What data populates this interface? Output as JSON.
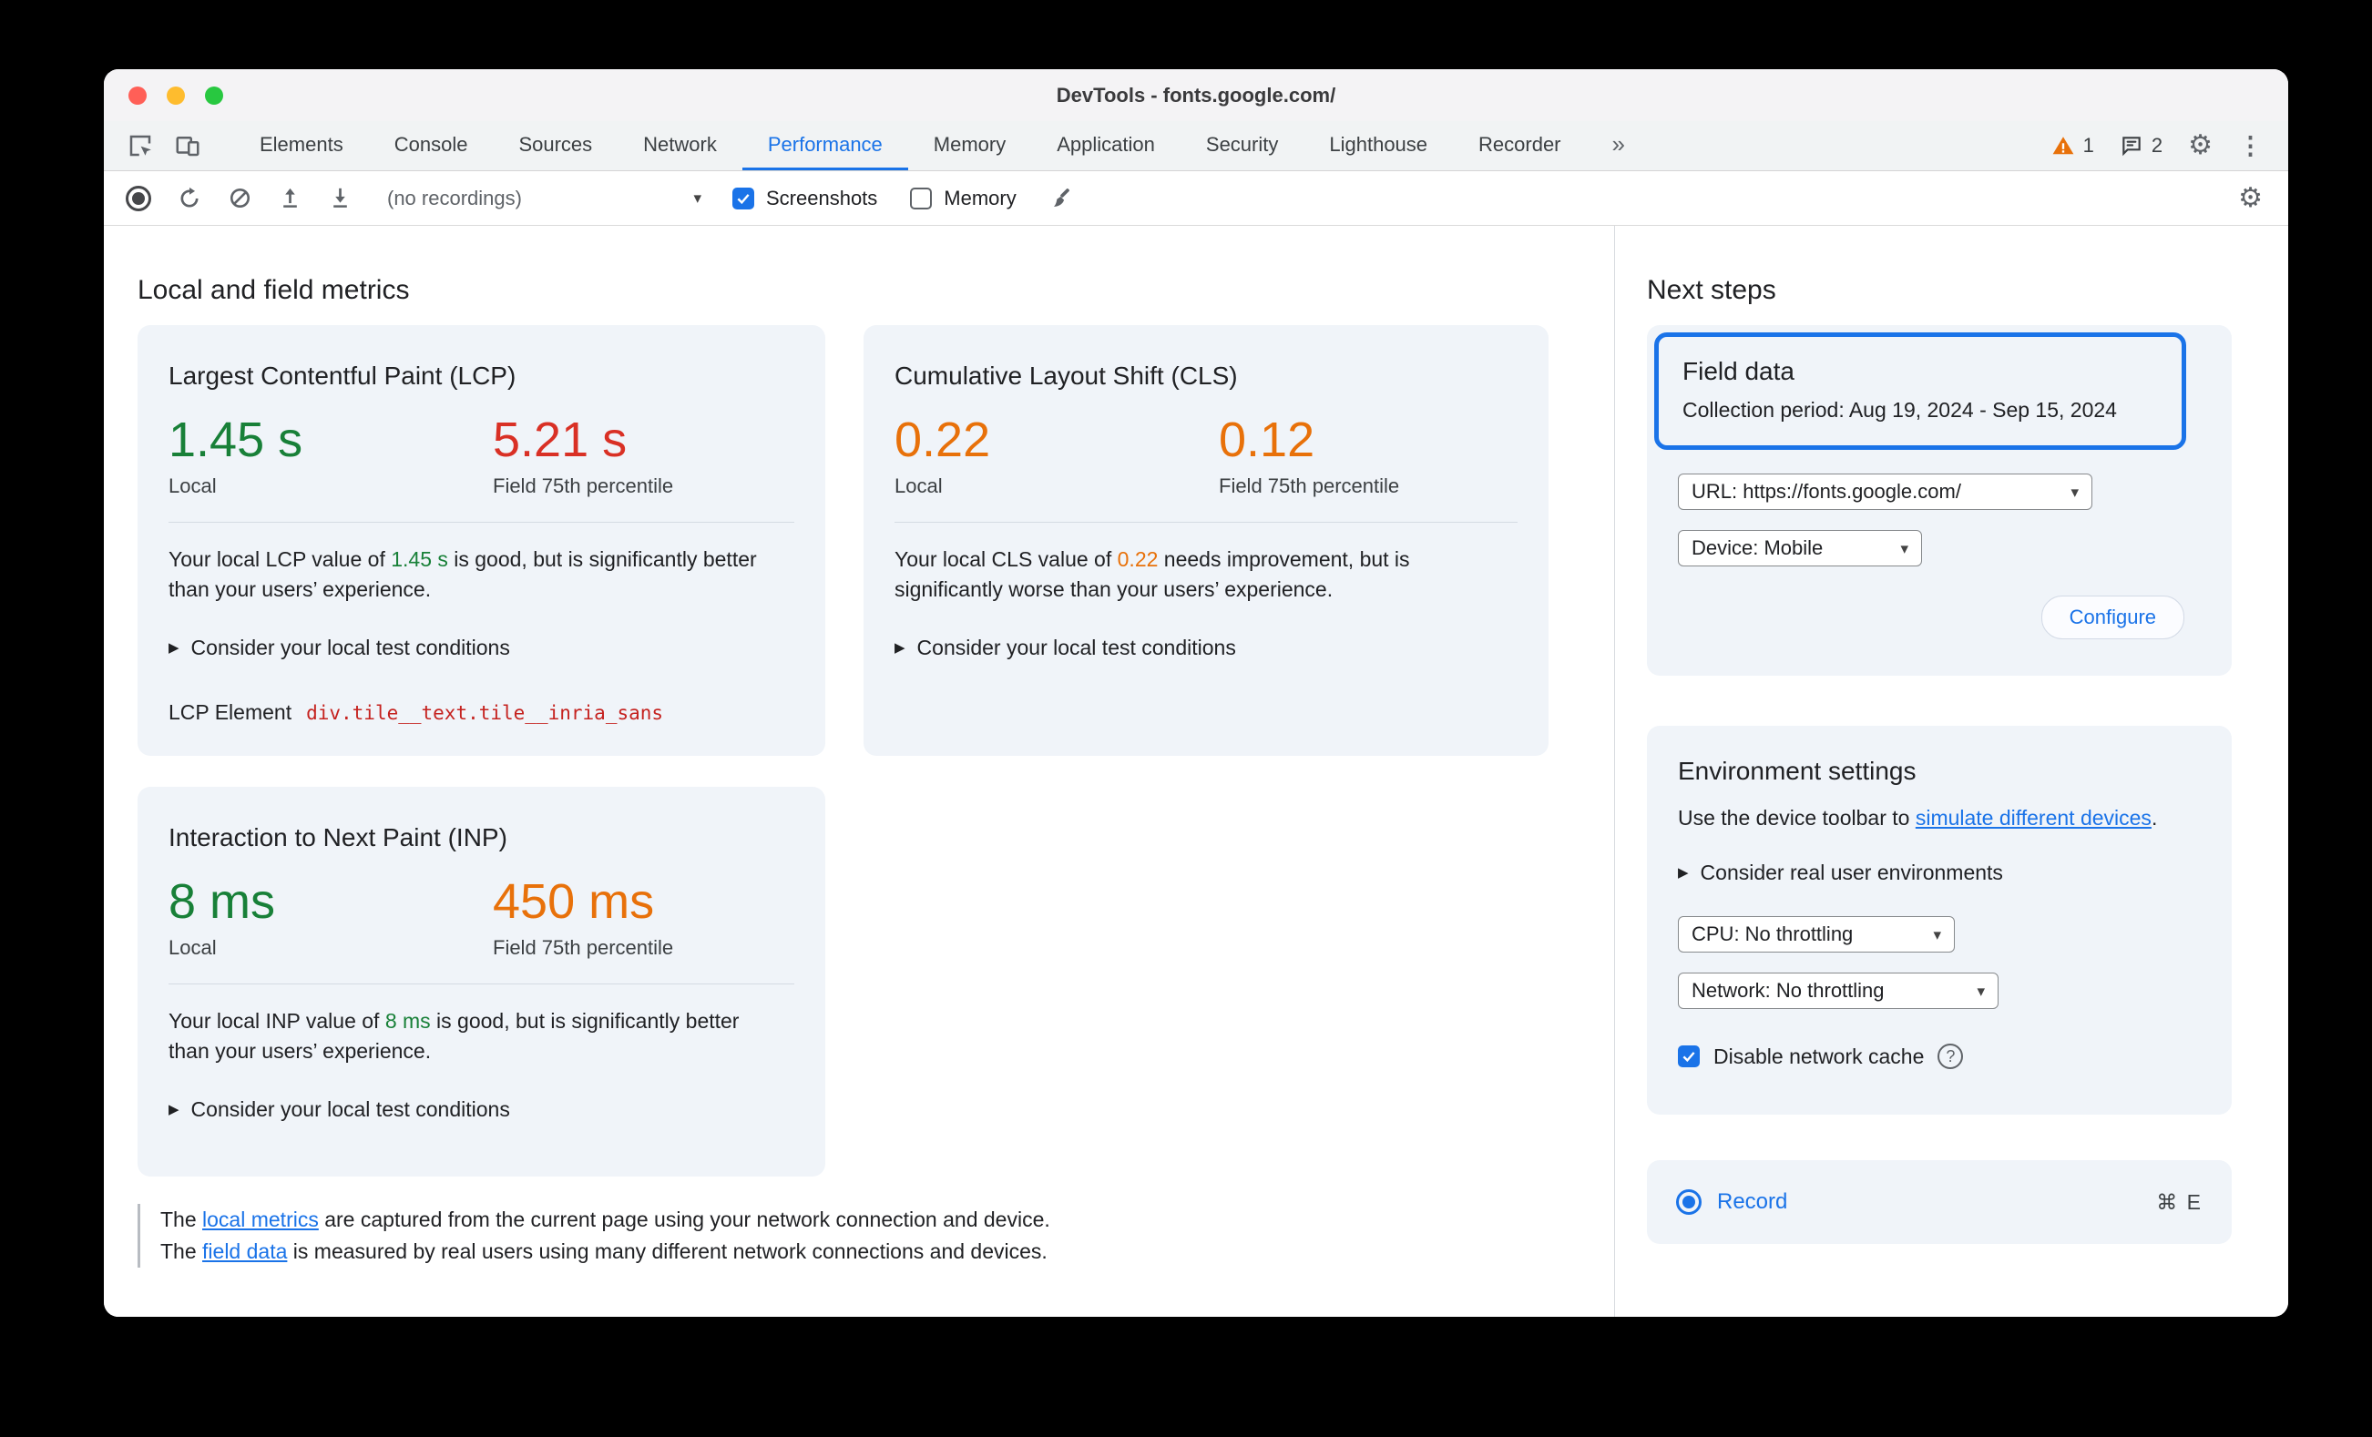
{
  "colors": {
    "good_green": "#188038",
    "poor_red": "#d93025",
    "warn_orange": "#e8710a",
    "accent_blue": "#1a73e8"
  },
  "icons": {
    "gear": "⚙",
    "kebab": "⋮",
    "caret": "▾",
    "disclosure": "▶",
    "more_tabs": "»",
    "help": "?"
  },
  "window": {
    "title": "DevTools - fonts.google.com/"
  },
  "tabbar": {
    "tabs": [
      {
        "label": "Elements"
      },
      {
        "label": "Console"
      },
      {
        "label": "Sources"
      },
      {
        "label": "Network"
      },
      {
        "label": "Performance"
      },
      {
        "label": "Memory"
      },
      {
        "label": "Application"
      },
      {
        "label": "Security"
      },
      {
        "label": "Lighthouse"
      },
      {
        "label": "Recorder"
      }
    ],
    "active_tab": "Performance",
    "warning_count": "1",
    "message_count": "2"
  },
  "toolbar": {
    "recordings_select": "(no recordings)",
    "screenshots_label": "Screenshots",
    "memory_label": "Memory"
  },
  "main": {
    "heading": "Local and field metrics",
    "lcp": {
      "title": "Largest Contentful Paint (LCP)",
      "local_value": "1.45 s",
      "local_label": "Local",
      "field_value": "5.21 s",
      "field_label": "Field 75th percentile",
      "desc_prefix": "Your local LCP value of ",
      "desc_value": "1.45 s",
      "desc_suffix": " is good, but is significantly better than your users’ experience.",
      "disclosure": "Consider your local test conditions",
      "element_label": "LCP Element",
      "element_value": "div.tile__text.tile__inria_sans"
    },
    "cls": {
      "title": "Cumulative Layout Shift (CLS)",
      "local_value": "0.22",
      "local_label": "Local",
      "field_value": "0.12",
      "field_label": "Field 75th percentile",
      "desc_prefix": "Your local CLS value of ",
      "desc_value": "0.22",
      "desc_suffix": " needs improvement, but is significantly worse than your users’ experience.",
      "disclosure": "Consider your local test conditions"
    },
    "inp": {
      "title": "Interaction to Next Paint (INP)",
      "local_value": "8 ms",
      "local_label": "Local",
      "field_value": "450 ms",
      "field_label": "Field 75th percentile",
      "desc_prefix": "Your local INP value of ",
      "desc_value": "8 ms",
      "desc_suffix": " is good, but is significantly better than your users’ experience.",
      "disclosure": "Consider your local test conditions"
    },
    "footer": {
      "line1_prefix": "The ",
      "line1_link": "local metrics",
      "line1_suffix": " are captured from the current page using your network connection and device.",
      "line2_prefix": "The ",
      "line2_link": "field data",
      "line2_suffix": " is measured by real users using many different network connections and devices."
    }
  },
  "sidebar": {
    "heading": "Next steps",
    "field_data": {
      "title": "Field data",
      "period": "Collection period: Aug 19, 2024 - Sep 15, 2024",
      "url_select": "URL: https://fonts.google.com/",
      "device_select": "Device: Mobile",
      "configure_button": "Configure"
    },
    "environment": {
      "title": "Environment settings",
      "desc_prefix": "Use the device toolbar to ",
      "desc_link": "simulate different devices",
      "desc_suffix": ".",
      "disclosure": "Consider real user environments",
      "cpu_select": "CPU: No throttling",
      "network_select": "Network: No throttling",
      "cache_label": "Disable network cache"
    },
    "record": {
      "label": "Record",
      "shortcut": "⌘ E"
    }
  }
}
